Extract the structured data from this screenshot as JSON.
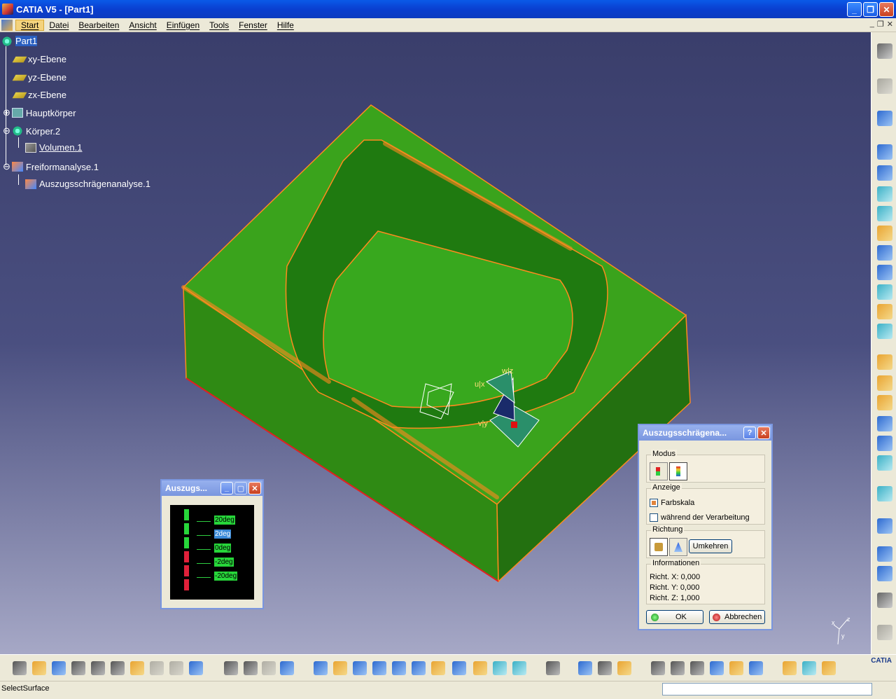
{
  "window": {
    "title": "CATIA V5 - [Part1]",
    "min_label": "_",
    "max_label": "❐",
    "close_label": "✕"
  },
  "menu": {
    "items": [
      "Start",
      "Datei",
      "Bearbeiten",
      "Ansicht",
      "Einfügen",
      "Tools",
      "Fenster",
      "Hilfe"
    ]
  },
  "tree": {
    "root": "Part1",
    "nodes": [
      "xy-Ebene",
      "yz-Ebene",
      "zx-Ebene",
      "Hauptkörper",
      "Körper.2",
      "Volumen.1",
      "Freiformanalyse.1",
      "Auszugsschrägenanalyse.1"
    ]
  },
  "compass": {
    "u": "u|x",
    "v": "v|y",
    "w": "w|z"
  },
  "scale_dialog": {
    "title": "Auszugs...",
    "labels": [
      "20deg",
      "2deg",
      "0deg",
      "-2deg",
      "-20deg"
    ],
    "colors": [
      "#27d63a",
      "#27d63a",
      "#27d63a",
      "#e0203a",
      "#e0203a",
      "#e0203a"
    ]
  },
  "analysis_dialog": {
    "title": "Auszugsschrägena...",
    "help_label": "?",
    "close_label": "✕",
    "modus_title": "Modus",
    "anzeige_title": "Anzeige",
    "farbskala_label": "Farbskala",
    "farbskala_checked": true,
    "verarbeitung_label": "während der Verarbeitung",
    "verarbeitung_checked": false,
    "richtung_title": "Richtung",
    "umkehren_label": "Umkehren",
    "info_title": "Informationen",
    "richt_x": "Richt. X: 0,000",
    "richt_y": "Richt. Y: 0,000",
    "richt_z": "Richt. Z: 1,000",
    "ok_label": "OK",
    "cancel_label": "Abbrechen"
  },
  "status": {
    "text": "SelectSurface",
    "command_value": ""
  },
  "logo": "CATIA",
  "axis": {
    "x": "x",
    "y": "y",
    "z": "z"
  }
}
